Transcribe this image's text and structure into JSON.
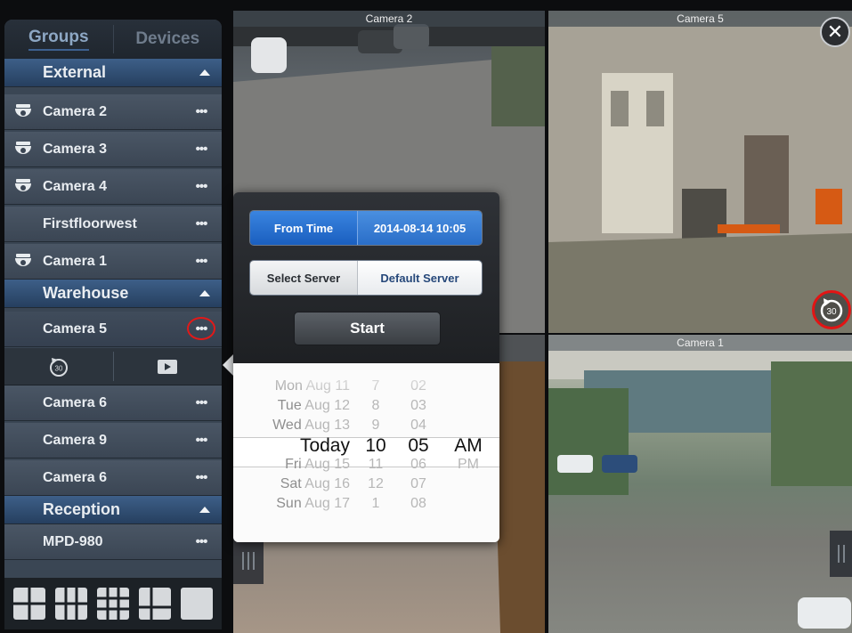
{
  "sidebar": {
    "tabs": [
      {
        "label": "Groups",
        "active": true
      },
      {
        "label": "Devices",
        "active": false
      }
    ],
    "rows": [
      {
        "kind": "group",
        "label": "External"
      },
      {
        "kind": "camera",
        "label": "Camera 2",
        "icon": "dome-camera-icon",
        "menu": "•••"
      },
      {
        "kind": "camera",
        "label": "Camera 3",
        "icon": "dome-camera-icon",
        "menu": "•••"
      },
      {
        "kind": "camera",
        "label": "Camera 4",
        "icon": "dome-camera-icon",
        "menu": "•••"
      },
      {
        "kind": "camera",
        "label": "Firstfloorwest",
        "icon": "",
        "menu": "•••"
      },
      {
        "kind": "camera",
        "label": "Camera 1",
        "icon": "dome-camera-icon",
        "menu": "•••"
      },
      {
        "kind": "group",
        "label": "Warehouse"
      },
      {
        "kind": "camera",
        "label": "Camera 5",
        "icon": "",
        "menu": "•••",
        "selected": true
      },
      {
        "kind": "camera",
        "label": "Camera 6",
        "icon": "",
        "menu": "•••"
      },
      {
        "kind": "camera",
        "label": "Camera 9",
        "icon": "",
        "menu": "•••"
      },
      {
        "kind": "camera",
        "label": "Camera 6",
        "icon": "",
        "menu": "•••"
      },
      {
        "kind": "group",
        "label": "Reception"
      },
      {
        "kind": "camera",
        "label": "MPD-980",
        "icon": "",
        "menu": "•••"
      }
    ],
    "playback_bar": {
      "rewind_label": "30",
      "rewind_icon": "rewind-30-icon",
      "play_icon": "playback-icon"
    },
    "layouts": [
      "layout-2x2-icon",
      "layout-3x3-icon",
      "layout-4x4-icon",
      "layout-1-plus-icon",
      "layout-single-icon"
    ]
  },
  "feeds": {
    "cam2": {
      "label": "Camera 2"
    },
    "cam5": {
      "label": "Camera 5"
    },
    "cam1": {
      "label": "Camera 1"
    }
  },
  "controls": {
    "close_label": "✕",
    "skip_label": "30"
  },
  "popover": {
    "from_time_label": "From Time",
    "from_time_value": "2014-08-14 10:05",
    "select_server_label": "Select Server",
    "server_value": "Default Server",
    "start_label": "Start",
    "picker": [
      {
        "date_day": "Mon",
        "date_rest": " Aug 11",
        "hour": "7",
        "minute": "02",
        "ampm": ""
      },
      {
        "date_day": "Tue",
        "date_rest": " Aug 12",
        "hour": "8",
        "minute": "03",
        "ampm": ""
      },
      {
        "date_day": "Wed",
        "date_rest": " Aug 13",
        "hour": "9",
        "minute": "04",
        "ampm": ""
      },
      {
        "date_day": "Today",
        "date_rest": "",
        "hour": "10",
        "minute": "05",
        "ampm": "AM",
        "current": true
      },
      {
        "date_day": "Fri",
        "date_rest": " Aug 15",
        "hour": "11",
        "minute": "06",
        "ampm": "PM"
      },
      {
        "date_day": "Sat",
        "date_rest": " Aug 16",
        "hour": "12",
        "minute": "07",
        "ampm": ""
      },
      {
        "date_day": "Sun",
        "date_rest": " Aug 17",
        "hour": "1",
        "minute": "08",
        "ampm": ""
      }
    ]
  }
}
